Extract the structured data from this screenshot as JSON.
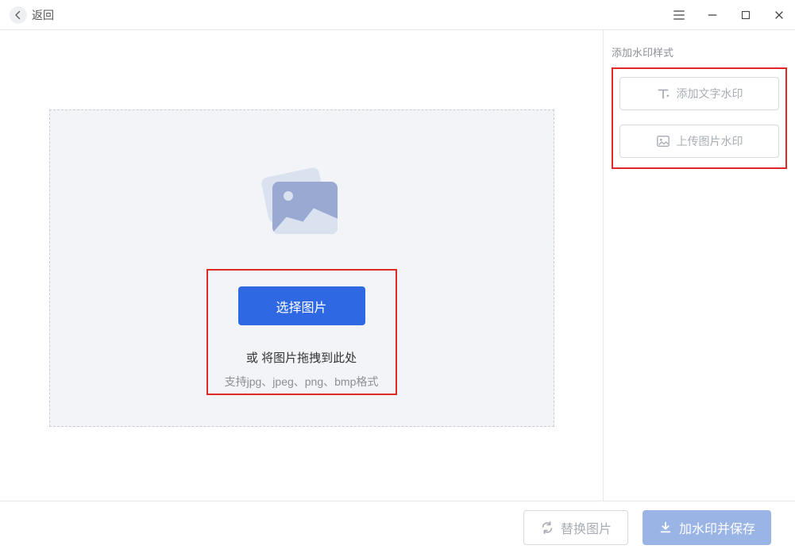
{
  "header": {
    "back_label": "返回"
  },
  "dropzone": {
    "select_button": "选择图片",
    "drag_text": "或 将图片拖拽到此处",
    "format_text": "支持jpg、jpeg、png、bmp格式"
  },
  "sidebar": {
    "title": "添加水印样式",
    "text_watermark": "添加文字水印",
    "image_watermark": "上传图片水印"
  },
  "footer": {
    "replace_image": "替换图片",
    "save_with_watermark": "加水印并保存"
  },
  "colors": {
    "primary": "#2f68e3",
    "highlight": "#dd2a25",
    "muted": "#a8adb5"
  }
}
